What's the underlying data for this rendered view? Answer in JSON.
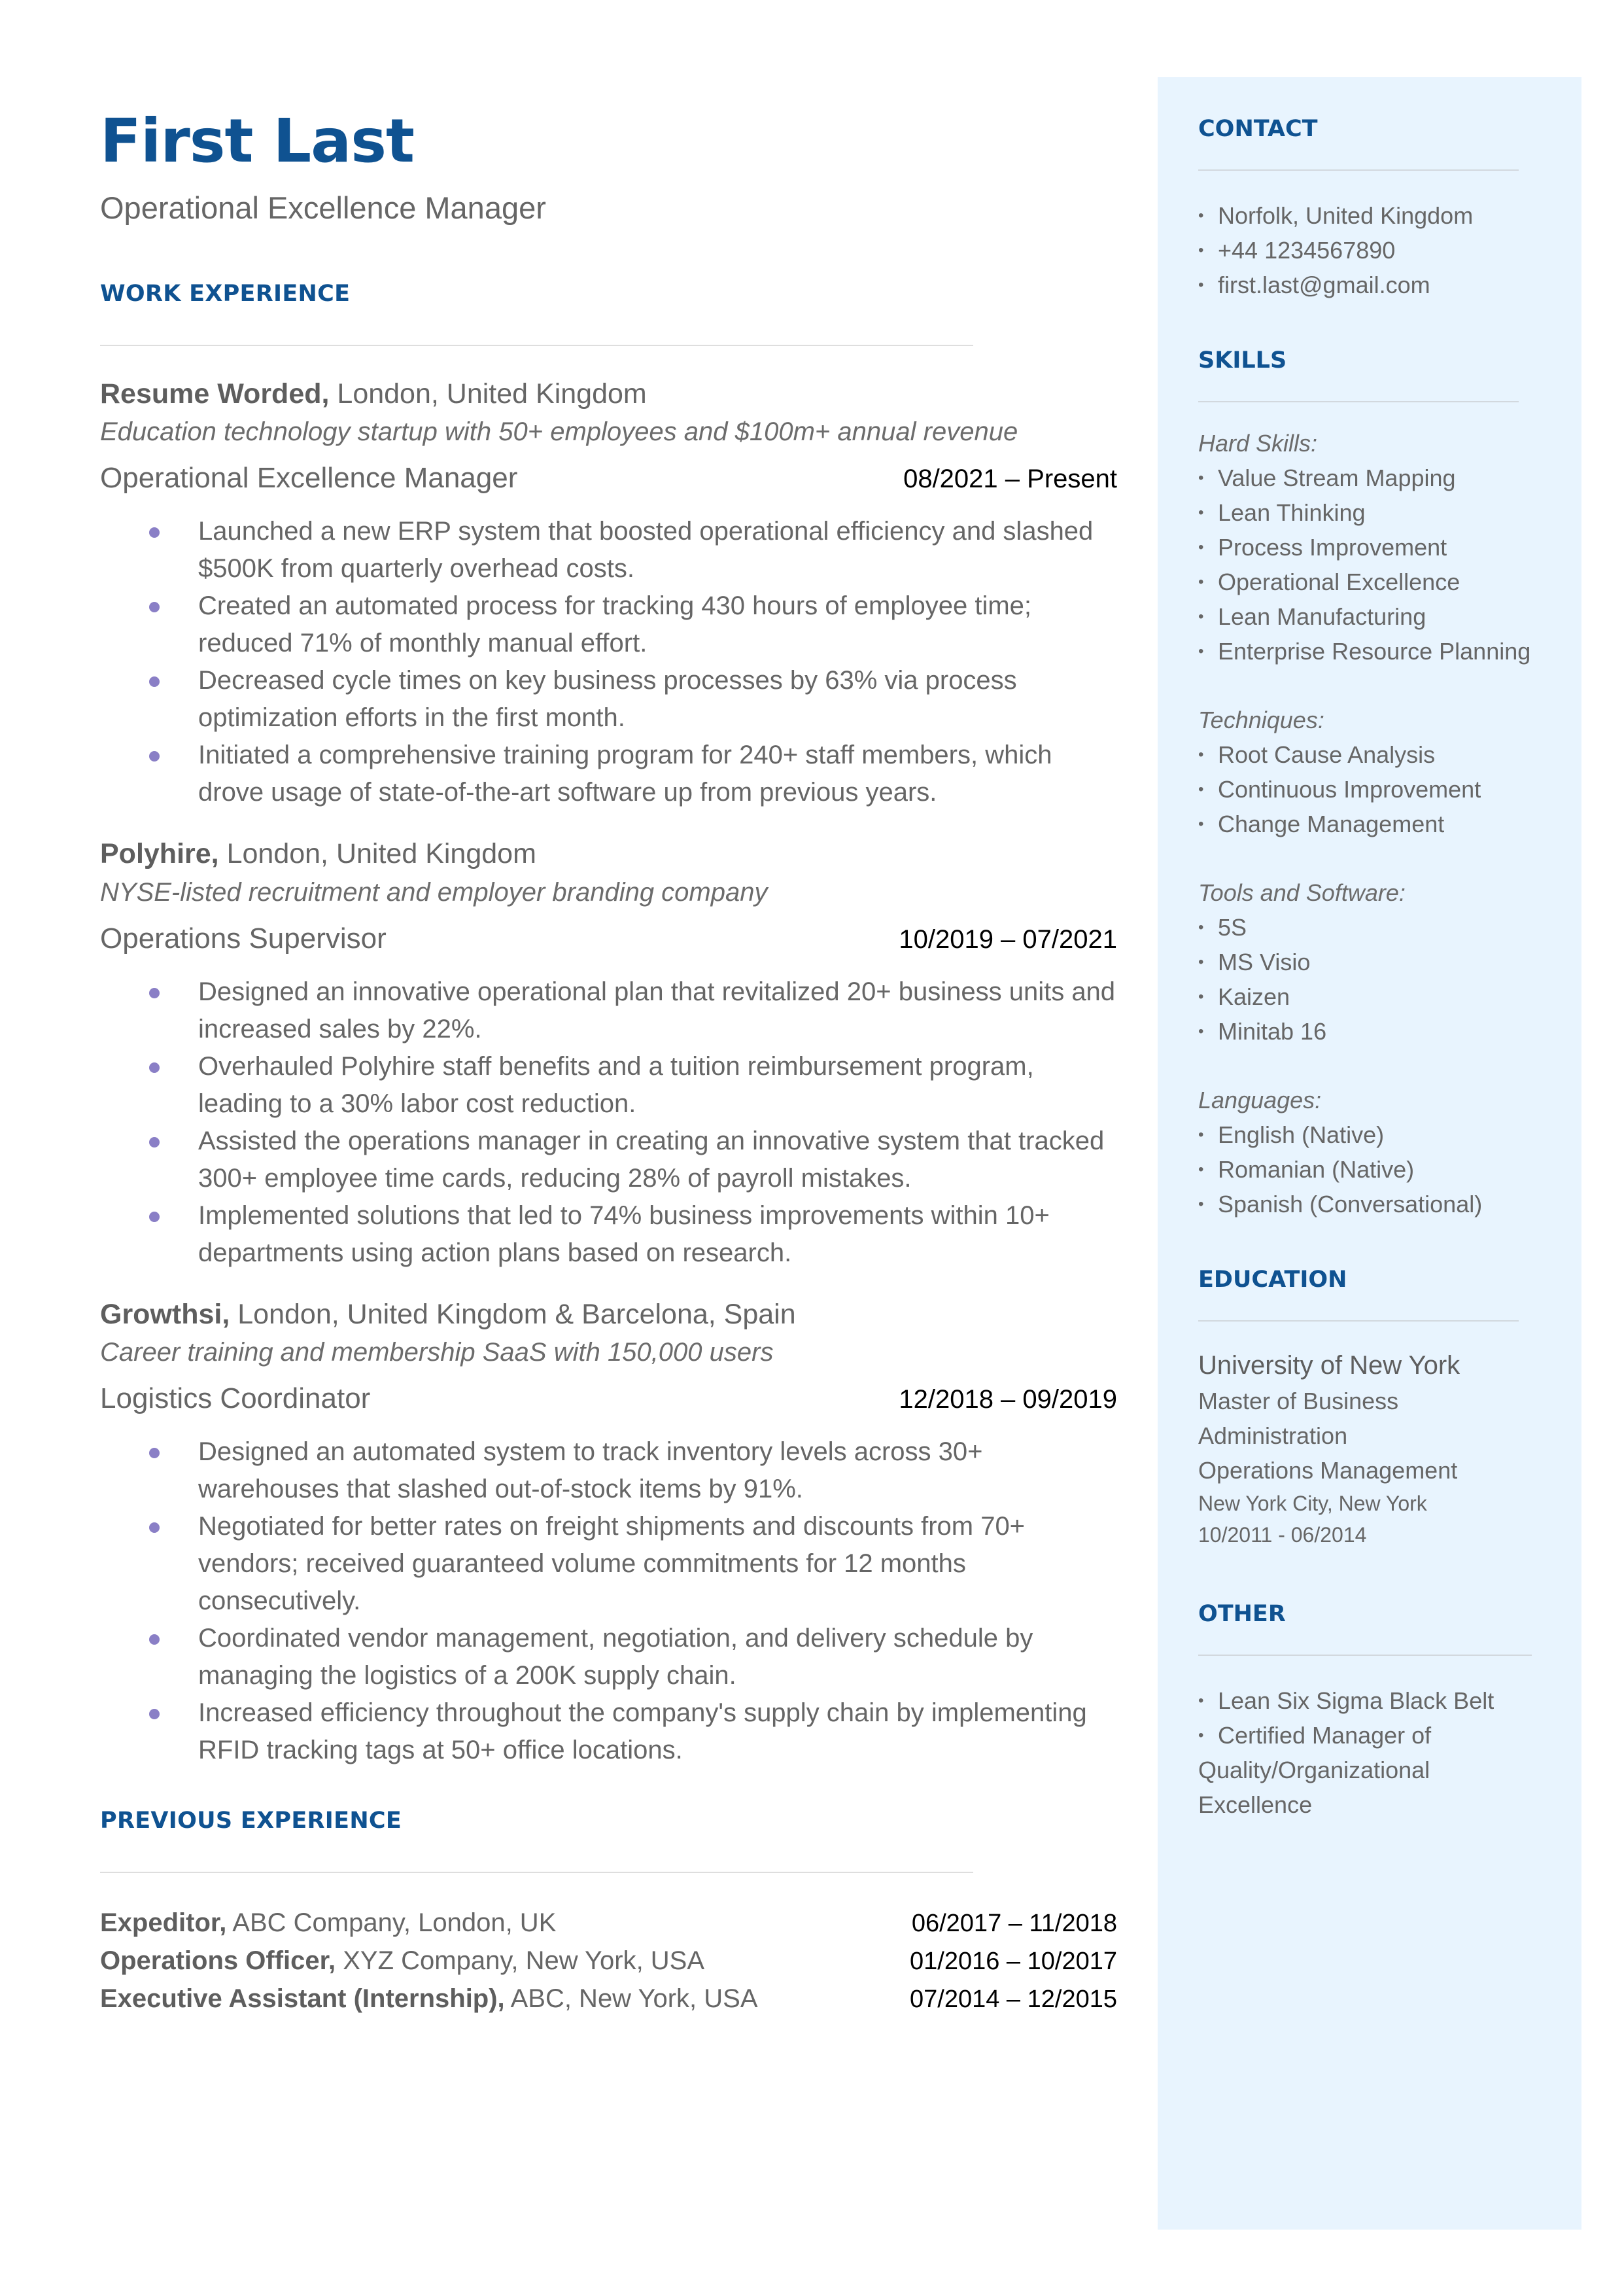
{
  "header": {
    "name": "First Last",
    "title": "Operational Excellence Manager"
  },
  "colors": {
    "accent": "#0f5291",
    "bullet": "#8a7fc6",
    "sidebar_bg": "#e8f4fe",
    "text": "#666666"
  },
  "work_experience": {
    "heading": "WORK EXPERIENCE",
    "jobs": [
      {
        "company": "Resume Worded,",
        "location": " London, United Kingdom",
        "description": "Education technology startup with 50+ employees and $100m+ annual revenue",
        "role": "Operational Excellence Manager",
        "dates": "08/2021 – Present",
        "bullets": [
          "Launched a new ERP system that boosted operational efficiency and slashed $500K from quarterly overhead costs.",
          "Created an automated process for tracking 430 hours of employee time; reduced 71% of monthly manual effort.",
          "Decreased cycle times on key business processes by 63% via process optimization efforts in the first month.",
          "Initiated a comprehensive training program for 240+ staff members, which drove usage of state-of-the-art software up from previous years."
        ]
      },
      {
        "company": "Polyhire,",
        "location": " London, United Kingdom",
        "description": "NYSE-listed recruitment and employer branding company",
        "role": "Operations Supervisor",
        "dates": "10/2019 – 07/2021",
        "bullets": [
          "Designed an innovative operational plan that revitalized 20+ business units and increased sales by 22%.",
          "Overhauled Polyhire staff benefits and a tuition reimbursement program, leading to a 30% labor cost reduction.",
          "Assisted the operations manager in creating an innovative system that tracked 300+ employee time cards, reducing 28% of payroll mistakes.",
          "Implemented solutions that led to 74% business improvements within 10+ departments using action plans based on research."
        ]
      },
      {
        "company": "Growthsi,",
        "location": " London, United Kingdom & Barcelona, Spain",
        "description": "Career training and membership SaaS with 150,000 users",
        "role": "Logistics Coordinator",
        "dates": "12/2018 – 09/2019",
        "bullets": [
          "Designed an automated system to track inventory levels across 30+ warehouses that slashed out-of-stock items by 91%.",
          "Negotiated for better rates on freight shipments and discounts from 70+ vendors; received guaranteed volume commitments for 12 months consecutively.",
          "Coordinated vendor management, negotiation, and delivery schedule by managing the logistics of a 200K supply chain.",
          "Increased efficiency throughout the company's supply chain by implementing RFID tracking tags at 50+ office locations."
        ]
      }
    ]
  },
  "previous_experience": {
    "heading": "PREVIOUS EXPERIENCE",
    "items": [
      {
        "title": "Expeditor,",
        "org": " ABC Company, London, UK",
        "dates": "06/2017 – 11/2018"
      },
      {
        "title": "Operations Officer,",
        "org": " XYZ Company, New York, USA",
        "dates": "01/2016 – 10/2017"
      },
      {
        "title": "Executive Assistant (Internship),",
        "org": " ABC, New York, USA",
        "dates": "07/2014 – 12/2015"
      }
    ]
  },
  "sidebar": {
    "contact": {
      "heading": "CONTACT",
      "items": [
        "Norfolk, United Kingdom",
        "+44 1234567890",
        "first.last@gmail.com"
      ]
    },
    "skills": {
      "heading": "SKILLS",
      "groups": [
        {
          "label": "Hard Skills:",
          "items": [
            "Value Stream Mapping",
            "Lean Thinking",
            "Process Improvement",
            "Operational Excellence",
            "Lean Manufacturing",
            "Enterprise Resource Planning"
          ]
        },
        {
          "label": "Techniques:",
          "items": [
            "Root Cause Analysis",
            "Continuous Improvement",
            "Change Management"
          ]
        },
        {
          "label": "Tools and Software:",
          "items": [
            "5S",
            "MS Visio",
            "Kaizen",
            "Minitab 16"
          ]
        },
        {
          "label": "Languages:",
          "items": [
            "English (Native)",
            "Romanian (Native)",
            "Spanish (Conversational)"
          ]
        }
      ]
    },
    "education": {
      "heading": "EDUCATION",
      "school": "University of New York",
      "degree_line1": "Master of Business",
      "degree_line2": "Administration",
      "field": "Operations Management",
      "location": "New York City, New York",
      "dates": "10/2011 - 06/2014"
    },
    "other": {
      "heading": "OTHER",
      "item1": "Lean Six Sigma Black Belt",
      "item2": "Certified Manager of",
      "item2_cont1": "Quality/Organizational",
      "item2_cont2": "Excellence"
    }
  }
}
